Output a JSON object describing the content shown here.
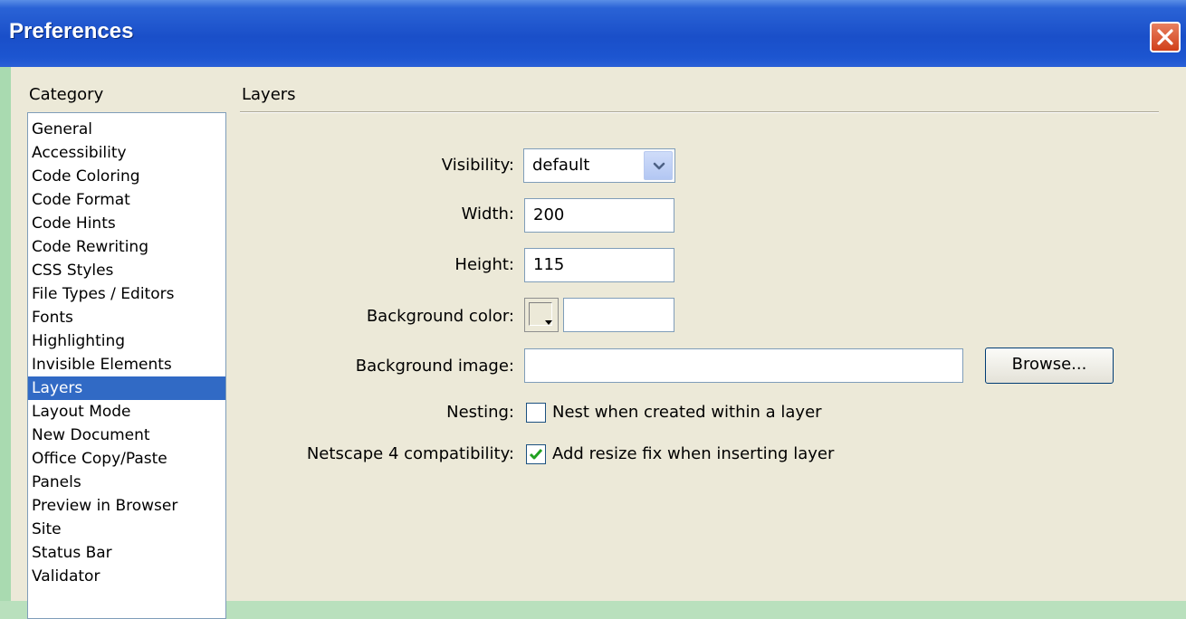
{
  "window": {
    "title": "Preferences"
  },
  "sidebar": {
    "heading": "Category",
    "items": [
      {
        "label": "General",
        "selected": false
      },
      {
        "label": "Accessibility",
        "selected": false
      },
      {
        "label": "Code Coloring",
        "selected": false
      },
      {
        "label": "Code Format",
        "selected": false
      },
      {
        "label": "Code Hints",
        "selected": false
      },
      {
        "label": "Code Rewriting",
        "selected": false
      },
      {
        "label": "CSS Styles",
        "selected": false
      },
      {
        "label": "File Types / Editors",
        "selected": false
      },
      {
        "label": "Fonts",
        "selected": false
      },
      {
        "label": "Highlighting",
        "selected": false
      },
      {
        "label": "Invisible Elements",
        "selected": false
      },
      {
        "label": "Layers",
        "selected": true
      },
      {
        "label": "Layout Mode",
        "selected": false
      },
      {
        "label": "New Document",
        "selected": false
      },
      {
        "label": "Office Copy/Paste",
        "selected": false
      },
      {
        "label": "Panels",
        "selected": false
      },
      {
        "label": "Preview in Browser",
        "selected": false
      },
      {
        "label": "Site",
        "selected": false
      },
      {
        "label": "Status Bar",
        "selected": false
      },
      {
        "label": "Validator",
        "selected": false
      }
    ]
  },
  "panel": {
    "heading": "Layers",
    "visibility": {
      "label": "Visibility:",
      "value": "default"
    },
    "width": {
      "label": "Width:",
      "value": "200"
    },
    "height": {
      "label": "Height:",
      "value": "115"
    },
    "bg_color": {
      "label": "Background color:",
      "value": ""
    },
    "bg_image": {
      "label": "Background image:",
      "value": "",
      "browse_label": "Browse..."
    },
    "nesting": {
      "label": "Nesting:",
      "checkbox_label": "Nest when created within a layer",
      "checked": false
    },
    "netscape": {
      "label": "Netscape 4 compatibility:",
      "checkbox_label": "Add resize fix when inserting layer",
      "checked": true
    }
  },
  "colors": {
    "title_bar": "#1a4fc9",
    "dialog_bg": "#ece9d8",
    "selection": "#316ac5",
    "check_mark": "#21a121",
    "close_button": "#d0401a"
  }
}
